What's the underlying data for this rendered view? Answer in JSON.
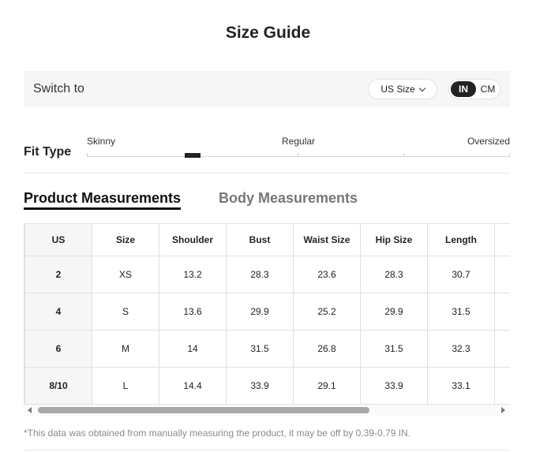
{
  "title": "Size Guide",
  "switch_bar": {
    "label": "Switch to",
    "size_select": "US Size",
    "units": {
      "active": "IN",
      "inactive": "CM"
    }
  },
  "fit_type": {
    "label": "Fit Type",
    "scale": [
      "Skinny",
      "Regular",
      "Oversized"
    ],
    "selected_position": 0.24
  },
  "tabs": {
    "active": "Product Measurements",
    "inactive": "Body Measurements"
  },
  "table": {
    "headers": [
      "US",
      "Size",
      "Shoulder",
      "Bust",
      "Waist Size",
      "Hip Size",
      "Length",
      ""
    ],
    "rows": [
      [
        "2",
        "XS",
        "13.2",
        "28.3",
        "23.6",
        "28.3",
        "30.7",
        ""
      ],
      [
        "4",
        "S",
        "13.6",
        "29.9",
        "25.2",
        "29.9",
        "31.5",
        ""
      ],
      [
        "6",
        "M",
        "14",
        "31.5",
        "26.8",
        "31.5",
        "32.3",
        ""
      ],
      [
        "8/10",
        "L",
        "14.4",
        "33.9",
        "29.1",
        "33.9",
        "33.1",
        ""
      ]
    ]
  },
  "note": "*This data was obtained from manually measuring the product, it may be off by 0.39-0.79 IN.",
  "colors": {
    "accent": "#222222",
    "bar_bg": "#f6f6f6",
    "note": "#8a8a8a"
  }
}
